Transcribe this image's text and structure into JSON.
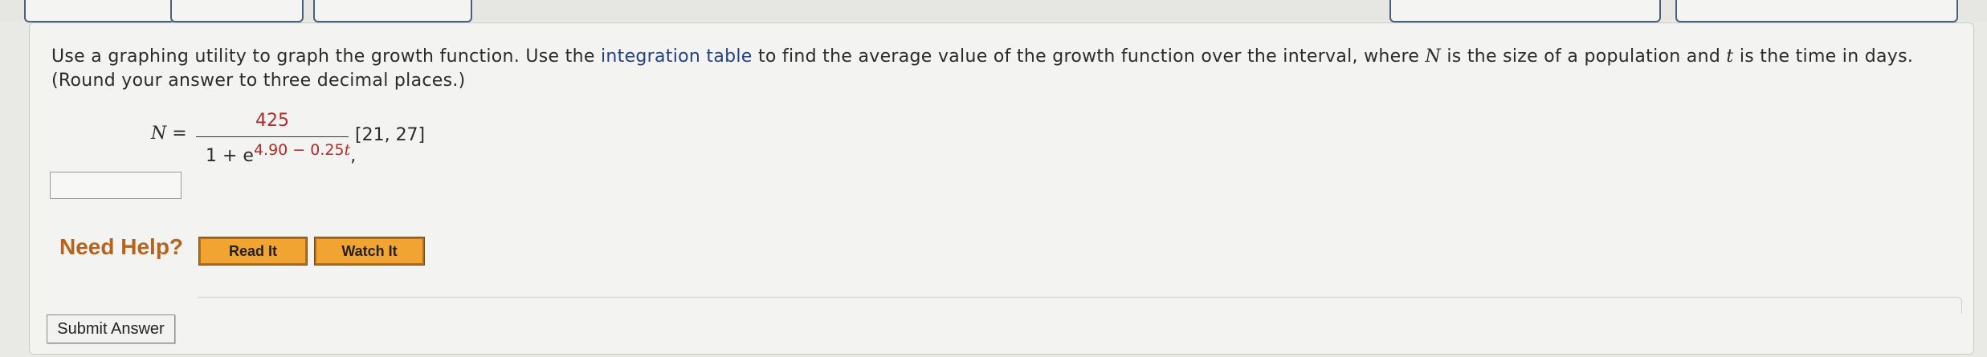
{
  "question": {
    "text_before_link": "Use a graphing utility to graph the growth function. Use the ",
    "link_text": "integration table",
    "text_part2": " to find the average value of the growth function over the interval, where ",
    "var_N": "N",
    "text_part3": " is the size of a population and ",
    "var_t": "t",
    "text_part4": " is the time in days.",
    "line2": "(Round your answer to three decimal places.)"
  },
  "formula": {
    "lhs": "N",
    "equals": " =",
    "numerator": "425",
    "den_base": "1 + e",
    "exponent_const": "4.90 − 0.25",
    "exponent_var": "t",
    "comma": ",",
    "interval": " [21, 27]"
  },
  "answer": {
    "value": ""
  },
  "help": {
    "label": "Need Help?",
    "read_it": "Read It",
    "watch_it": "Watch It"
  },
  "submit": {
    "label": "Submit Answer"
  },
  "colors": {
    "link": "#23408a",
    "accent_red": "#b22a2a",
    "help_orange": "#b8631d",
    "help_button": "#f1a432"
  }
}
